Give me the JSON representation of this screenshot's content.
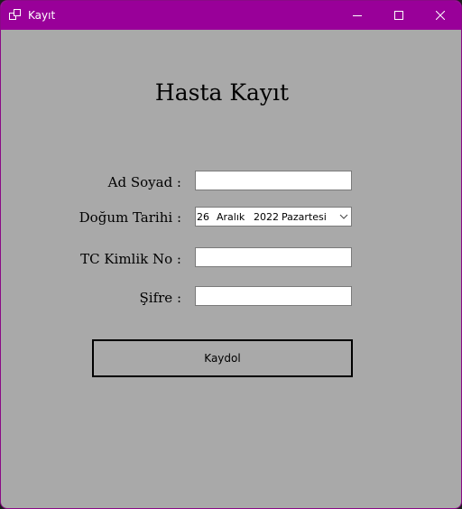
{
  "window": {
    "title": "Kayıt",
    "titlebar_color": "#990099",
    "background_color": "#a9a9a9"
  },
  "form": {
    "heading": "Hasta Kayıt",
    "name_label": "Ad Soyad :",
    "name_value": "",
    "birthdate_label": "Doğum Tarihi :",
    "birthdate": {
      "day": "26",
      "month": "Aralık",
      "year": "2022",
      "weekday": "Pazartesi"
    },
    "tc_label": "TC Kimlik No :",
    "tc_value": "",
    "password_label": "Şifre :",
    "password_value": "",
    "submit_label": "Kaydol"
  },
  "icons": {
    "app": "app-windows-icon",
    "minimize": "minimize-icon",
    "maximize": "maximize-icon",
    "close": "close-icon",
    "dropdown": "chevron-down-icon"
  }
}
